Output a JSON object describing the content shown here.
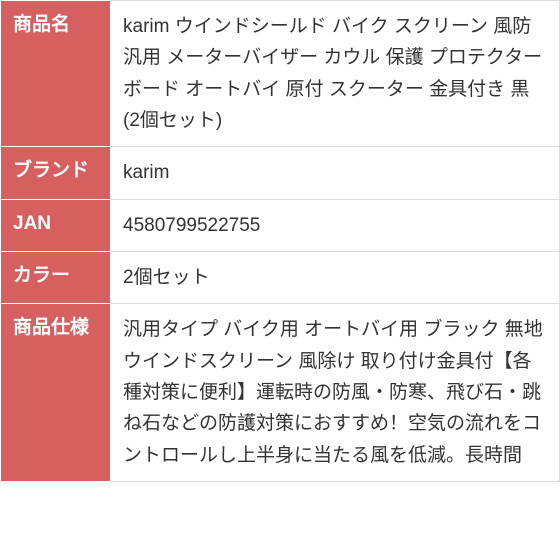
{
  "table": {
    "rows": [
      {
        "label": "商品名",
        "value": "karim ウインドシールド バイク スクリーン 風防 汎用 メーターバイザー カウル 保護 プロテクター ボード オートバイ 原付 スクーター 金具付き 黒 (2個セット)"
      },
      {
        "label": "ブランド",
        "value": "karim"
      },
      {
        "label": "JAN",
        "value": "4580799522755"
      },
      {
        "label": "カラー",
        "value": "2個セット"
      },
      {
        "label": "商品仕様",
        "value": "汎用タイプ バイク用 オートバイ用 ブラック 無地 ウインドスクリーン 風除け 取り付け金具付【各種対策に便利】運転時の防風・防寒、飛び石・跳ね石などの防護対策におすすめ！空気の流れをコントロールし上半身に当たる風を低減。長時間"
      }
    ]
  }
}
